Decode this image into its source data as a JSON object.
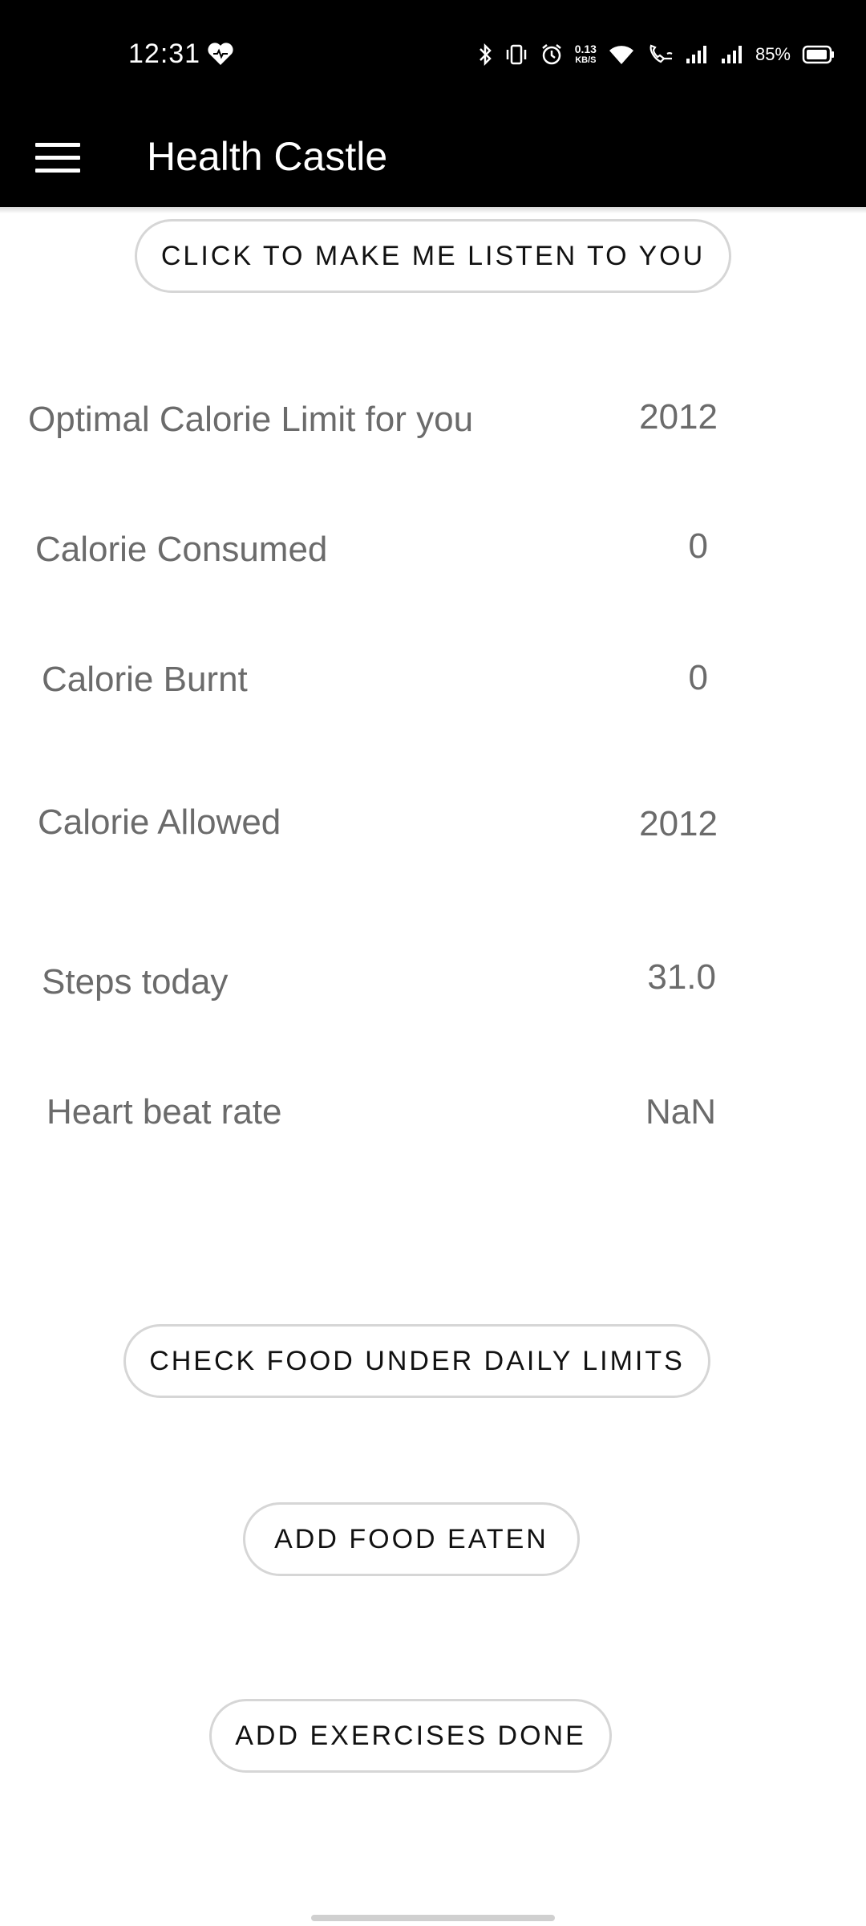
{
  "status_bar": {
    "time": "12:31",
    "net_speed_value": "0.13",
    "net_speed_unit": "KB/S",
    "battery_percent": "85%",
    "icons": [
      "heart-icon",
      "bluetooth-icon",
      "vibrate-icon",
      "alarm-icon",
      "wifi-icon",
      "wifi-call-icon",
      "signal-icon",
      "signal-icon",
      "battery-icon"
    ]
  },
  "app_bar": {
    "title": "Health Castle",
    "menu_icon": "menu-icon"
  },
  "buttons": {
    "listen": "CLICK TO MAKE ME LISTEN TO YOU",
    "check_food": "CHECK FOOD UNDER DAILY LIMITS",
    "add_food": "ADD FOOD EATEN",
    "add_exercises": "ADD EXERCISES DONE"
  },
  "stats": {
    "optimal_label": "Optimal Calorie Limit for you",
    "optimal_value": "2012",
    "consumed_label": "Calorie Consumed",
    "consumed_value": "0",
    "burnt_label": "Calorie Burnt",
    "burnt_value": "0",
    "allowed_label": "Calorie Allowed",
    "allowed_value": "2012",
    "steps_label": "Steps today",
    "steps_value": "31.0",
    "heart_label": "Heart beat rate",
    "heart_value": "NaN"
  },
  "colors": {
    "bar_background": "#000000",
    "label_text": "#6b6b6b",
    "button_border": "#d6d6d6"
  }
}
